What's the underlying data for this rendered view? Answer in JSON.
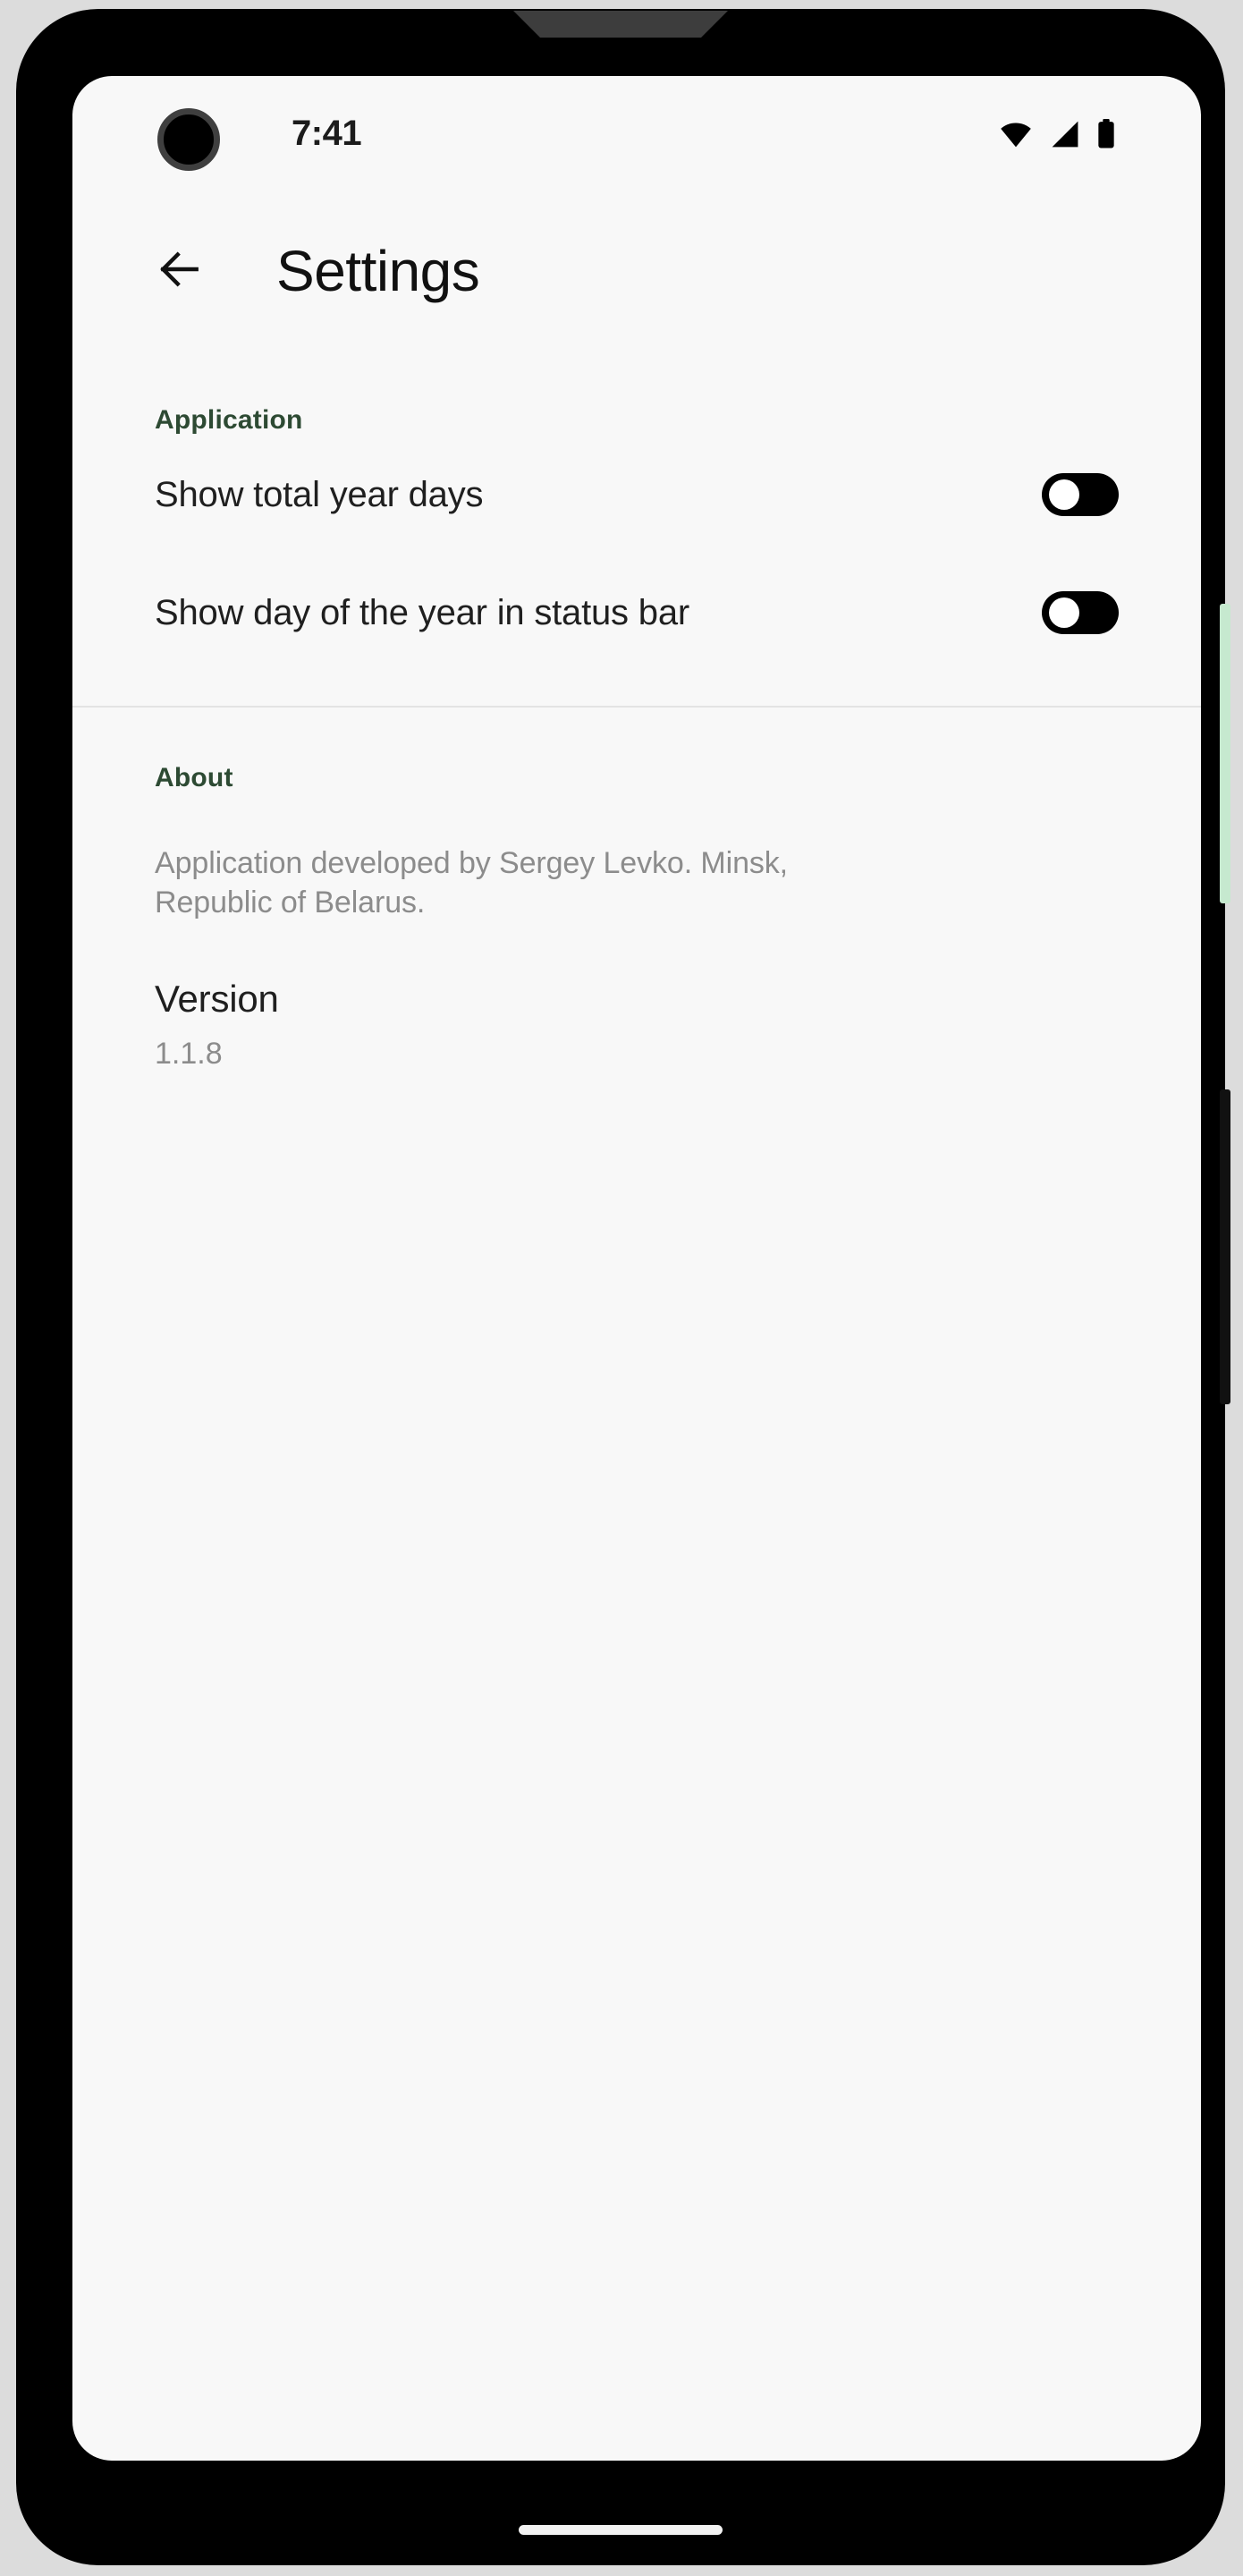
{
  "status_bar": {
    "time": "7:41",
    "icons": [
      {
        "name": "wifi-icon",
        "label": "wifi"
      },
      {
        "name": "cellular-signal-icon",
        "label": "signal"
      },
      {
        "name": "battery-icon",
        "label": "battery"
      }
    ],
    "camera": "front-camera-punch-hole"
  },
  "app_bar": {
    "back_label": "back",
    "title": "Settings"
  },
  "sections": {
    "application": {
      "header": "Application",
      "rows": [
        {
          "label": "Show total year days",
          "checked": false
        },
        {
          "label": "Show day of the year in status bar",
          "checked": false
        }
      ]
    },
    "about": {
      "header": "About",
      "description": "Application developed by Sergey Levko. Minsk, Republic of Belarus.",
      "version_title": "Version",
      "version_value": "1.1.8"
    }
  },
  "device": {
    "volume_button": "volume-button",
    "power_button": "power-button",
    "speaker_notch": "earpiece-speaker",
    "gesture_bar": "home-gesture-bar"
  },
  "colors": {
    "accent_green": "#2d4a33",
    "screen_bg": "#f8f8f8",
    "primary_text": "#1f1f1f",
    "secondary_text": "#8c8c8c",
    "toggle_off_track": "#000000",
    "volume_button": "#c6e9cf"
  }
}
